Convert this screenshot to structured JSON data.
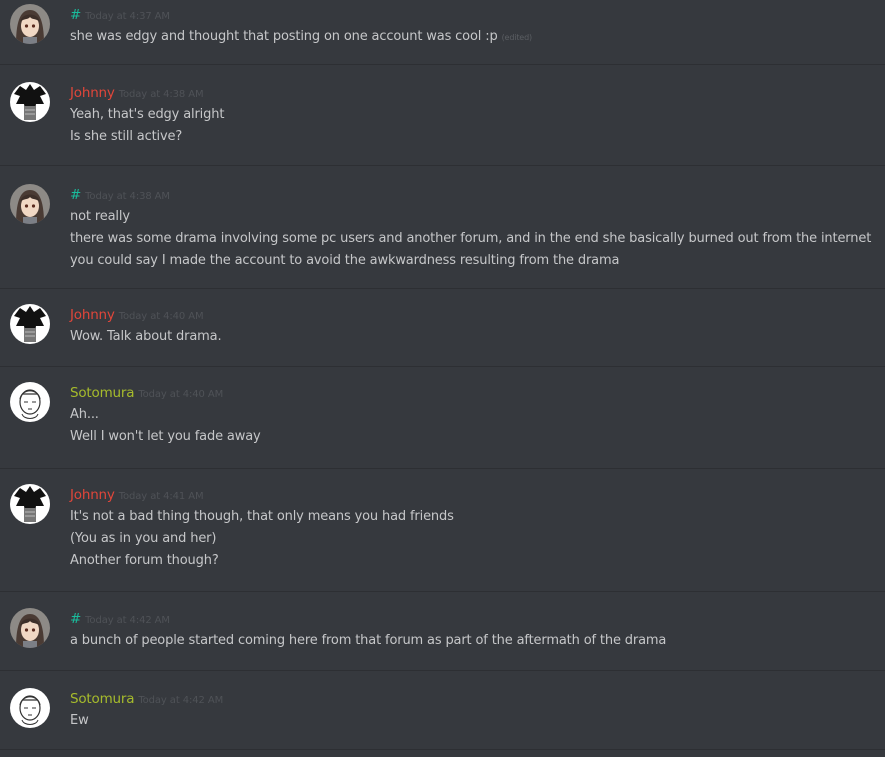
{
  "colors": {
    "background": "#36393e",
    "divider": "#2d2f33",
    "text": "#c6c7c9",
    "timestamp": "#4f5257",
    "johnny": "#e0463a",
    "sotomura": "#a6bb2c",
    "hash_user": "#1abc9c"
  },
  "messages": [
    {
      "author": "#",
      "author_color": "#1abc9c",
      "avatar": "anime-girl-avatar",
      "timestamp": "Today at 4:37 AM",
      "lines": [
        "she was edgy and thought that posting on one account was cool :p"
      ],
      "edited_label": "(edited)"
    },
    {
      "author": "Johnny",
      "author_color": "#e0463a",
      "avatar": "dark-figure-avatar",
      "timestamp": "Today at 4:38 AM",
      "lines": [
        "Yeah, that's edgy alright",
        "Is she still active?"
      ]
    },
    {
      "author": "#",
      "author_color": "#1abc9c",
      "avatar": "anime-girl-avatar",
      "timestamp": "Today at 4:38 AM",
      "lines": [
        "not really",
        "there was some drama involving some pc users and another forum, and in the end she basically burned out from the internet",
        "you could say I made the account to avoid the awkwardness resulting from the drama"
      ]
    },
    {
      "author": "Johnny",
      "author_color": "#e0463a",
      "avatar": "dark-figure-avatar",
      "timestamp": "Today at 4:40 AM",
      "lines": [
        "Wow. Talk about drama."
      ]
    },
    {
      "author": "Sotomura",
      "author_color": "#a6bb2c",
      "avatar": "sketch-avatar",
      "timestamp": "Today at 4:40 AM",
      "lines": [
        "Ah...",
        "Well I won't let you fade away"
      ]
    },
    {
      "author": "Johnny",
      "author_color": "#e0463a",
      "avatar": "dark-figure-avatar",
      "timestamp": "Today at 4:41 AM",
      "lines": [
        "It's not a bad thing though, that only means you had friends",
        "(You as in you and her)",
        "Another forum though?"
      ]
    },
    {
      "author": "#",
      "author_color": "#1abc9c",
      "avatar": "anime-girl-avatar",
      "timestamp": "Today at 4:42 AM",
      "lines": [
        "a bunch of people started coming here from that forum as part of the aftermath of the drama"
      ]
    },
    {
      "author": "Sotomura",
      "author_color": "#a6bb2c",
      "avatar": "sketch-avatar",
      "timestamp": "Today at 4:42 AM",
      "lines": [
        "Ew"
      ]
    }
  ]
}
